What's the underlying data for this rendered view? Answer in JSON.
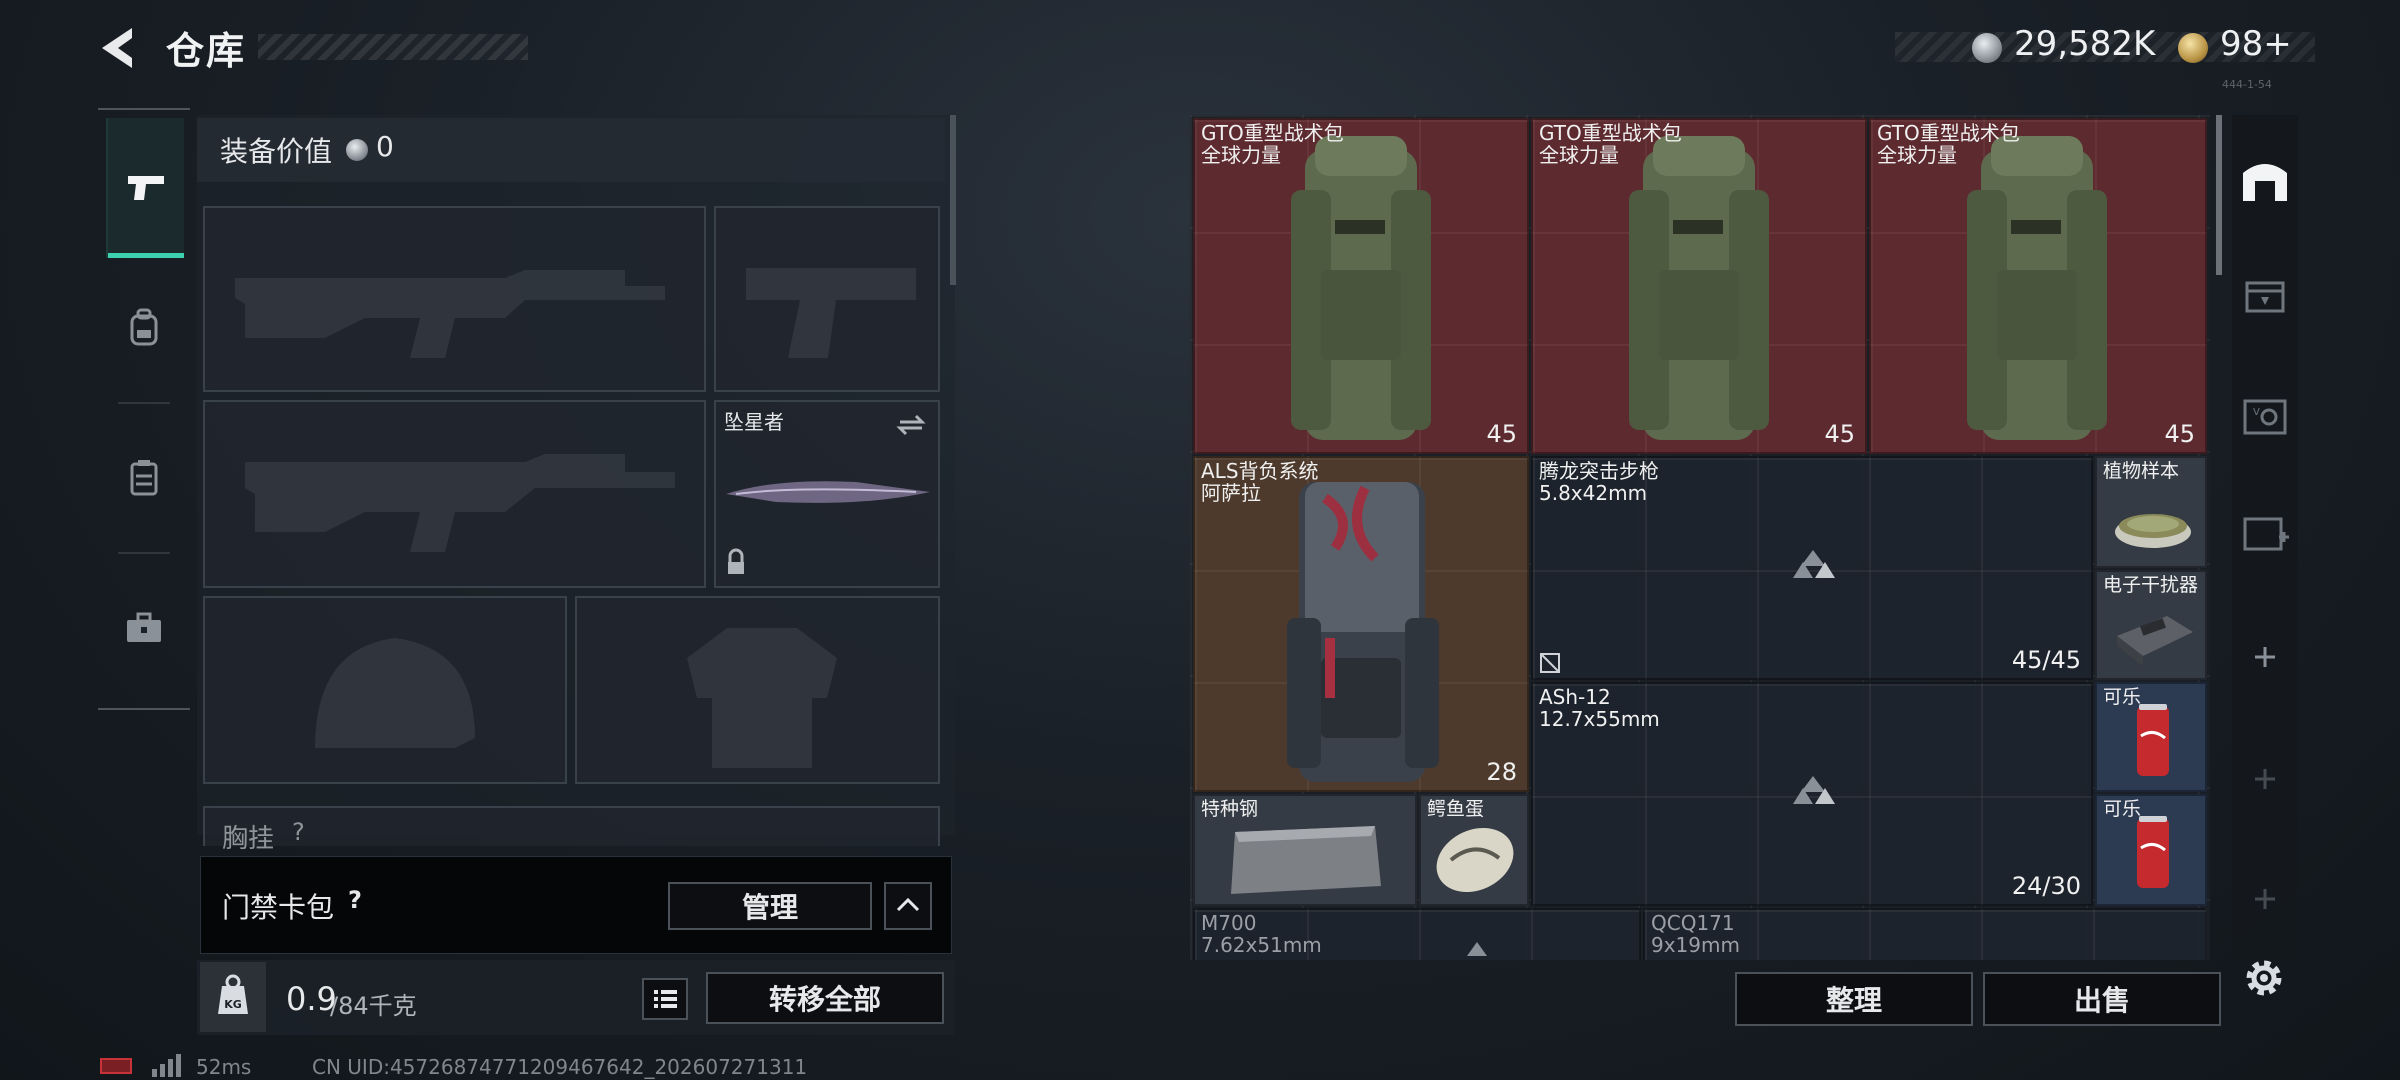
{
  "header": {
    "title": "仓库",
    "silver_amount": "29,582K",
    "gold_amount": "98+",
    "small_id": "444-1-54"
  },
  "loadout": {
    "value_label": "装备价值",
    "value_amount": "0",
    "melee_name": "坠星者",
    "chest_label": "胸挂",
    "chest_help": "?"
  },
  "keycard": {
    "label": "门禁卡包",
    "help": "?",
    "manage_label": "管理"
  },
  "weight": {
    "current": "0.9",
    "max": "/84千克",
    "transfer_label": "转移全部"
  },
  "status": {
    "ping": "52ms",
    "uid": "CN UID:45726874771209467642_202607271311"
  },
  "stash": {
    "items": [
      {
        "name": "GTO重型战术包\n全球力量",
        "count": "45"
      },
      {
        "name": "GTO重型战术包\n全球力量",
        "count": "45"
      },
      {
        "name": "GTO重型战术包\n全球力量",
        "count": "45"
      },
      {
        "name": "ALS背负系统\n阿萨拉",
        "count": "28"
      },
      {
        "name": "腾龙突击步枪\n5.8x42mm",
        "count": "45/45"
      },
      {
        "name": "植物样本"
      },
      {
        "name": "电子干扰器"
      },
      {
        "name": "ASh-12\n12.7x55mm",
        "count": "24/30"
      },
      {
        "name": "可乐"
      },
      {
        "name": "可乐"
      },
      {
        "name": "特种钢"
      },
      {
        "name": "鳄鱼蛋"
      },
      {
        "name": "M700\n7.62x51mm"
      },
      {
        "name": "QCQ171\n9x19mm"
      }
    ],
    "sort_label": "整理",
    "sell_label": "出售"
  },
  "colors": {
    "accent": "#3ed1b0",
    "red_bag": "#5d2a2f",
    "brown_bag": "#4d3a2c"
  }
}
